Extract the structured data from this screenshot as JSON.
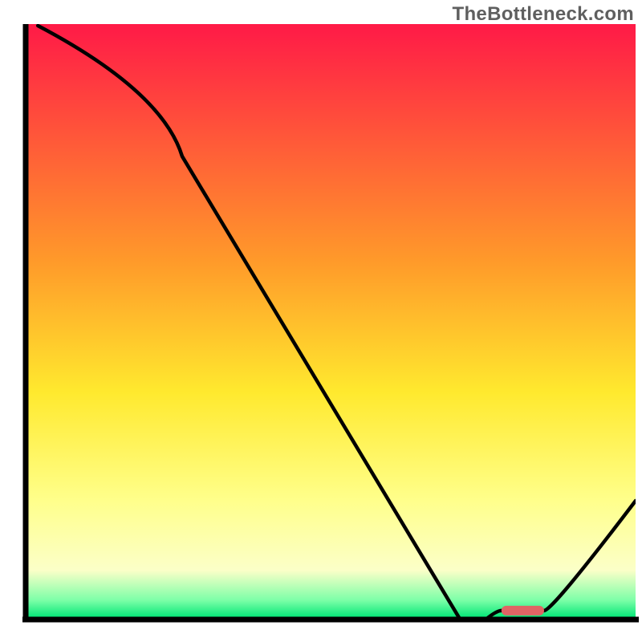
{
  "watermark": "TheBottleneck.com",
  "chart_data": {
    "type": "line",
    "title": "",
    "xlabel": "",
    "ylabel": "",
    "xlim": [
      0,
      100
    ],
    "ylim": [
      0,
      100
    ],
    "x": [
      2,
      25,
      78,
      82,
      85,
      100
    ],
    "values": [
      100,
      78,
      1.5,
      1.5,
      1.5,
      20
    ],
    "optimal_band": {
      "x_start": 78,
      "x_end": 85,
      "y": 1.5
    },
    "gradient_stops": [
      {
        "pct": 0,
        "color": "#ff1a47"
      },
      {
        "pct": 40,
        "color": "#ff9a2a"
      },
      {
        "pct": 62,
        "color": "#ffe92e"
      },
      {
        "pct": 80,
        "color": "#ffff8a"
      },
      {
        "pct": 92,
        "color": "#fbffc8"
      },
      {
        "pct": 97,
        "color": "#7dffa8"
      },
      {
        "pct": 100,
        "color": "#00e676"
      }
    ],
    "axis_color": "#000000",
    "curve_color": "#000000",
    "marker_color": "#e06464"
  }
}
